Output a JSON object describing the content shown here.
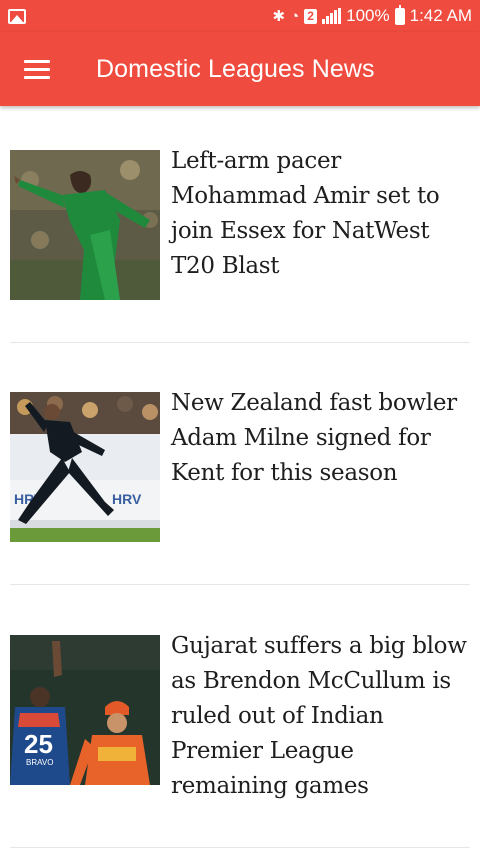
{
  "status_bar": {
    "battery_percent": "100%",
    "time": "1:42 AM",
    "sim_slot": "2",
    "icons": [
      "image-icon",
      "bluetooth-icon",
      "wifi-icon",
      "signal-icon",
      "battery-icon"
    ]
  },
  "app_bar": {
    "title": "Domestic Leagues News",
    "menu_icon": "hamburger-menu-icon",
    "color": "#ef4b3f"
  },
  "news": [
    {
      "headline": "Left-arm pacer Mohammad Amir set to join Essex for NatWest T20 Blast"
    },
    {
      "headline": "New Zealand fast bowler Adam Milne signed for Kent for this season"
    },
    {
      "headline": "Gujarat suffers a big blow as Brendon McCullum is ruled out of Indian Premier League remaining games"
    }
  ],
  "thumb_texts": {
    "sponsor_left": "HRV",
    "sponsor_right": "HRV",
    "jersey_number": "25",
    "jersey_name": "BRAVO"
  }
}
